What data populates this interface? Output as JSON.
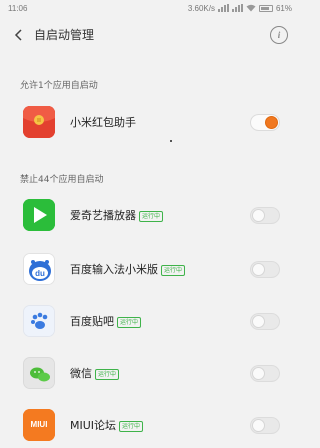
{
  "status_bar": {
    "time": "11:06",
    "network_speed": "3.60K/s",
    "battery": "61%"
  },
  "header": {
    "title": "自启动管理",
    "back_icon": "back-arrow-icon",
    "info_icon": "info-icon"
  },
  "sections": {
    "allowed_label": "允许1个应用自启动",
    "blocked_label": "禁止44个应用自启动"
  },
  "allowed_apps": [
    {
      "name": "小米红包助手",
      "enabled": true,
      "icon": "red-envelope-icon"
    }
  ],
  "blocked_apps": [
    {
      "name": "爱奇艺播放器",
      "badge": "运行中",
      "enabled": false,
      "icon": "iqiyi-play-icon"
    },
    {
      "name": "百度输入法小米版",
      "badge": "运行中",
      "enabled": false,
      "icon": "baidu-input-icon"
    },
    {
      "name": "百度贴吧",
      "badge": "运行中",
      "enabled": false,
      "icon": "baidu-tieba-paw-icon"
    },
    {
      "name": "微信",
      "badge": "运行中",
      "enabled": false,
      "icon": "wechat-icon"
    },
    {
      "name": "MIUI论坛",
      "badge": "运行中",
      "enabled": false,
      "icon": "miui-forum-icon"
    }
  ],
  "colors": {
    "accent": "#f07820",
    "running_badge": "#3fb34a",
    "background": "#f2f2f2"
  }
}
